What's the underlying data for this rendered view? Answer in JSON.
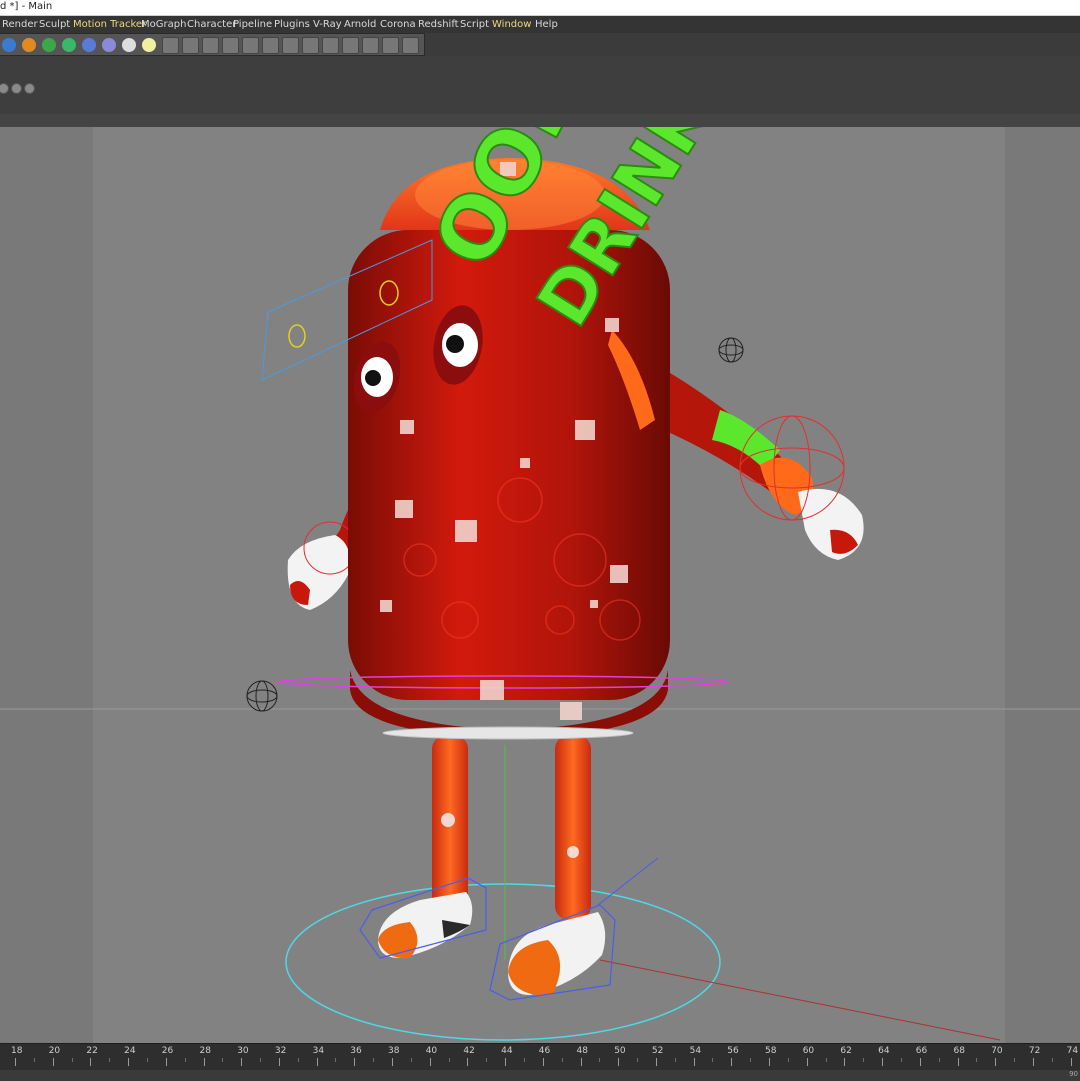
{
  "window": {
    "title": "d *] - Main"
  },
  "menu": [
    {
      "label": "Render",
      "highlight": false
    },
    {
      "label": "Sculpt",
      "highlight": false
    },
    {
      "label": "Motion Tracker",
      "highlight": true
    },
    {
      "label": "MoGraph",
      "highlight": false
    },
    {
      "label": "Character",
      "highlight": false
    },
    {
      "label": "Pipeline",
      "highlight": false
    },
    {
      "label": "Plugins",
      "highlight": false
    },
    {
      "label": "V-Ray",
      "highlight": false
    },
    {
      "label": "Arnold",
      "highlight": false
    },
    {
      "label": "Corona",
      "highlight": false
    },
    {
      "label": "Redshift",
      "highlight": false
    },
    {
      "label": "Script",
      "highlight": false
    },
    {
      "label": "Window",
      "highlight": true
    },
    {
      "label": "Help",
      "highlight": false
    }
  ],
  "toolbar": {
    "icons": [
      "cube-icon",
      "pen-icon",
      "subdivision-icon",
      "generator-icon",
      "deformer-icon",
      "floor-icon",
      "camera-icon",
      "light-icon",
      "grid-tool-icon-1",
      "grid-tool-icon-2",
      "grid-tool-icon-3",
      "grid-tool-icon-4",
      "grid-tool-icon-5",
      "grid-tool-icon-6",
      "grid-tool-icon-7",
      "grid-tool-icon-8",
      "grid-tool-icon-9",
      "grid-tool-icon-10",
      "grid-tool-icon-11",
      "grid-tool-icon-12",
      "grid-tool-icon-13"
    ]
  },
  "model": {
    "can_text_top": "OOL",
    "can_text_side": "DRINK",
    "colors": {
      "can": "#c8180c",
      "logo": "#5be82c",
      "accent": "#ff6a1a",
      "selection": "#4dd9e6",
      "ik_rings": "#e03030"
    }
  },
  "timeline": {
    "ticks": [
      "18",
      "20",
      "22",
      "24",
      "26",
      "28",
      "30",
      "32",
      "34",
      "36",
      "38",
      "40",
      "42",
      "44",
      "46",
      "48",
      "50",
      "52",
      "54",
      "56",
      "58",
      "60",
      "62",
      "64",
      "66",
      "68",
      "70",
      "72",
      "74"
    ],
    "end_value": "90"
  }
}
